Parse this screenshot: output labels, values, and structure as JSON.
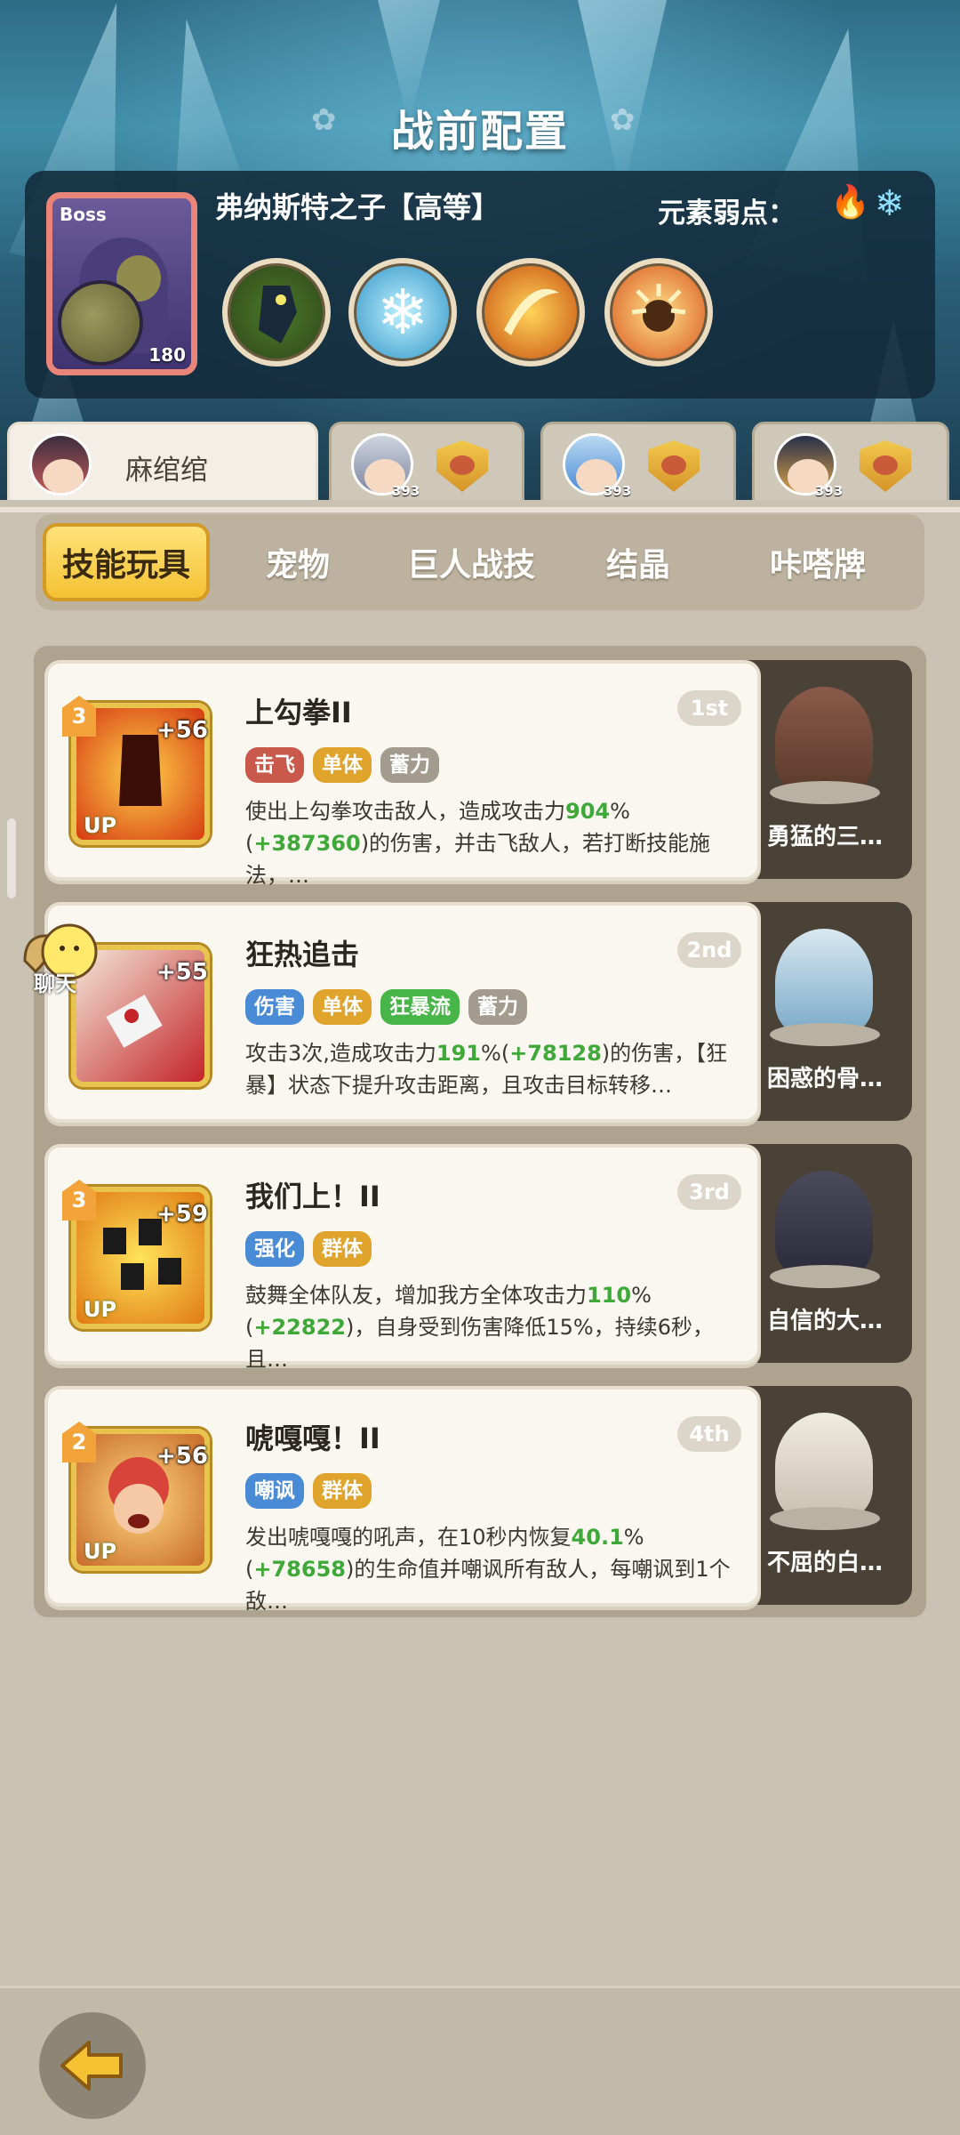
{
  "header": {
    "title": "战前配置",
    "boss": {
      "tag": "Boss",
      "level": "180",
      "name": "弗纳斯特之子【高等】",
      "weakness_label": "元素弱点：",
      "weakness_icons": [
        "fire-icon",
        "snowflake-icon"
      ],
      "skills": [
        "strike-skill",
        "ice-skill",
        "slash-skill",
        "explosion-skill"
      ]
    }
  },
  "party": [
    {
      "name": "麻绾绾",
      "level": "",
      "active": true
    },
    {
      "name": "",
      "level": "393",
      "active": false
    },
    {
      "name": "",
      "level": "393",
      "active": false
    },
    {
      "name": "",
      "level": "393",
      "active": false
    }
  ],
  "categories": [
    "技能玩具",
    "宠物",
    "巨人战技",
    "结晶",
    "咔嗒牌"
  ],
  "active_category": "技能玩具",
  "skills": [
    {
      "name": "上勾拳II",
      "rank": "1st",
      "level": "3",
      "plus": "+56",
      "up": "UP",
      "tags": [
        {
          "t": "击飞",
          "c": "red"
        },
        {
          "t": "单体",
          "c": "gold"
        },
        {
          "t": "蓄力",
          "c": "gray"
        }
      ],
      "desc_a": "使出上勾拳攻击敌人，造成攻击力",
      "desc_val": "904",
      "desc_b": "%(",
      "desc_bonus": "+387360",
      "desc_c": ")的伤害，并击飞敌人，若打断技能施法，…",
      "pet": "勇猛的三…"
    },
    {
      "name": "狂热追击",
      "rank": "2nd",
      "level": "",
      "plus": "+55",
      "up": "",
      "tags": [
        {
          "t": "伤害",
          "c": "blue"
        },
        {
          "t": "单体",
          "c": "gold"
        },
        {
          "t": "狂暴流",
          "c": "green"
        },
        {
          "t": "蓄力",
          "c": "gray"
        }
      ],
      "desc_a": "攻击3次,造成攻击力",
      "desc_val": "191",
      "desc_b": "%(",
      "desc_bonus": "+78128",
      "desc_c": ")的伤害，【狂暴】状态下提升攻击距离，且攻击目标转移…",
      "pet": "困惑的骨…"
    },
    {
      "name": "我们上！II",
      "rank": "3rd",
      "level": "3",
      "plus": "+59",
      "up": "UP",
      "tags": [
        {
          "t": "强化",
          "c": "blue"
        },
        {
          "t": "群体",
          "c": "gold"
        }
      ],
      "desc_a": "鼓舞全体队友，增加我方全体攻击力",
      "desc_val": "110",
      "desc_b": "%(",
      "desc_bonus": "+22822",
      "desc_c": ")，自身受到伤害降低15%，持续6秒，且…",
      "pet": "自信的大…"
    },
    {
      "name": "唬嘎嘎！II",
      "rank": "4th",
      "level": "2",
      "plus": "+56",
      "up": "UP",
      "tags": [
        {
          "t": "嘲讽",
          "c": "blue"
        },
        {
          "t": "群体",
          "c": "gold"
        }
      ],
      "desc_a": "发出唬嘎嘎的吼声，在10秒内恢复",
      "desc_val": "40.1",
      "desc_b": "%(",
      "desc_bonus": "+78658",
      "desc_c": ")的生命值并嘲讽所有敌人，每嘲讽到1个敌…",
      "pet": "不屈的白…"
    }
  ],
  "chat_label": "聊天",
  "colors": {
    "accent": "#f4c233",
    "green_value": "#3ea838",
    "panel": "#122a3a"
  }
}
